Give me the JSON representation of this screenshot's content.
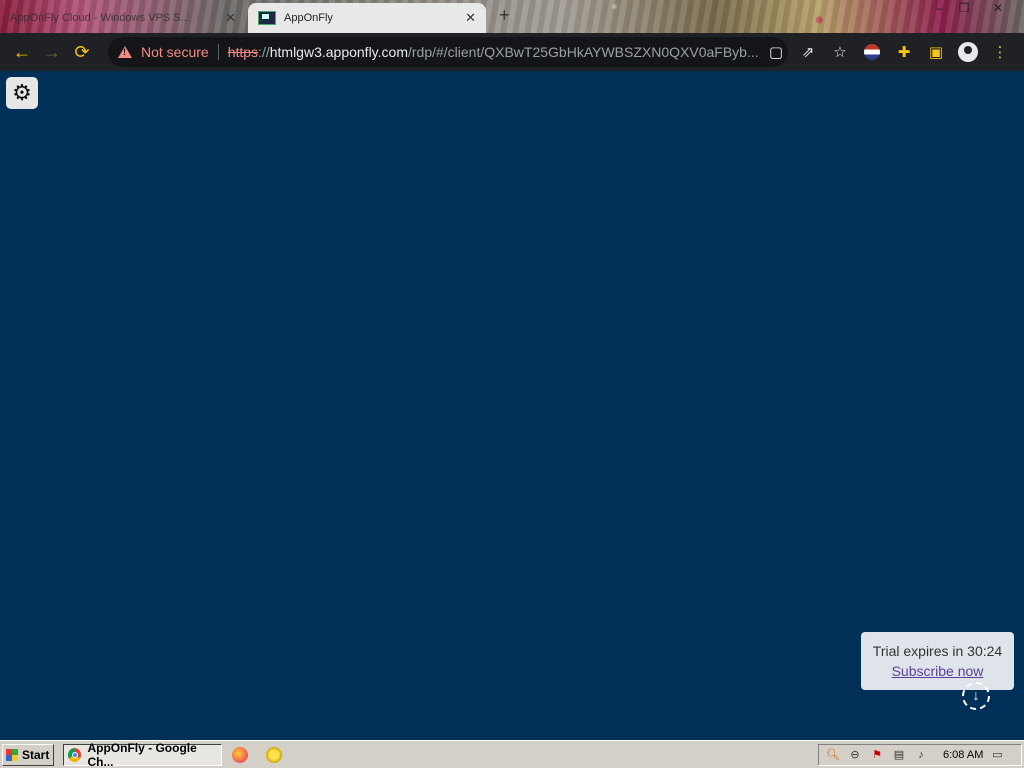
{
  "browser": {
    "tabs": [
      {
        "title": "AppOnFly Cloud - Windows VPS S...",
        "active": false
      },
      {
        "title": "AppOnFly",
        "active": true
      }
    ],
    "new_tab_label": "+",
    "window_controls": {
      "minimize": "–",
      "restore": "❐",
      "close": "✕"
    },
    "omnibox": {
      "security_text": "Not secure",
      "scheme": "https",
      "separator": "://",
      "host": "htmlgw3.apponfly.com",
      "path": "/rdp/#/client/QXBwT25GbHkAYWBSZXN0QXV0aFByb..."
    },
    "icons": {
      "back": "arrow-left-icon",
      "forward": "arrow-right-icon",
      "reload": "reload-icon",
      "warning": "warning-icon",
      "page": "page-icon",
      "share": "share-icon",
      "star": "star-icon",
      "extensions": "puzzle-icon",
      "sidepanel": "sidepanel-icon",
      "profile": "profile-icon",
      "menu": "kebab-menu-icon"
    },
    "colors": {
      "toolbar": "#202124",
      "warning": "#f28b82",
      "accent": "#f5c518"
    }
  },
  "remote_desktop": {
    "background": "#003057",
    "trial": {
      "text": "Trial expires in 30:24",
      "link": "Subscribe now"
    }
  },
  "taskbar": {
    "start_label": "Start",
    "task_button": "AppOnFly - Google Ch...",
    "clock": "6:08 AM"
  }
}
